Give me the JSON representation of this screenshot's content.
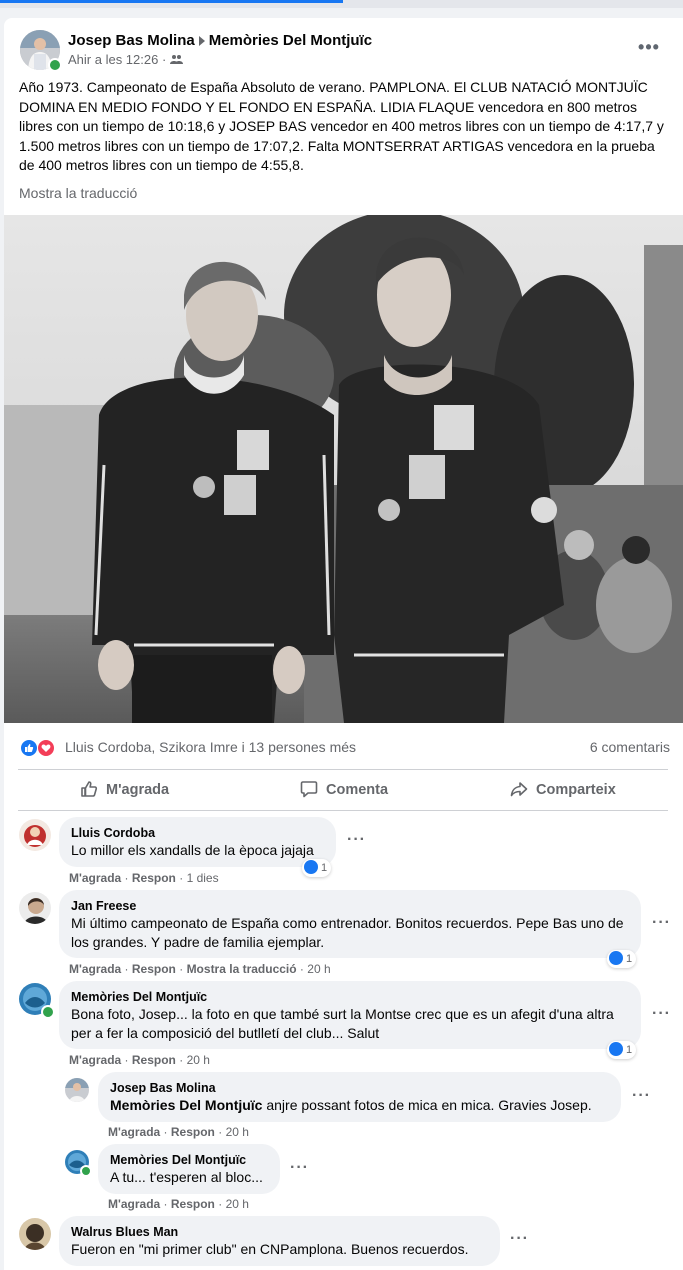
{
  "post": {
    "author": "Josep Bas Molina",
    "group": "Memòries Del Montjuïc",
    "timestamp": "Ahir a les 12:26",
    "audience_icon": "group-icon",
    "text": "Año 1973. Campeonato de España Absoluto de verano. PAMPLONA. El CLUB NATACIÓ MONTJUÏC DOMINA EN MEDIO FONDO Y EL FONDO EN ESPAÑA. LIDIA FLAQUE vencedora en 800 metros libres con un tiempo de 10:18,6 y JOSEP BAS vencedor en 400 metros libres con un tiempo de 4:17,7 y 1.500 metros libres con un tiempo de 17:07,2. Falta MONTSERRAT ARTIGAS vencedora en la prueba de 400 metros libres con un tiempo de 4:55,8.",
    "translate_link": "Mostra la traducció"
  },
  "reactions": {
    "names": "Lluis Cordoba, Szikora Imre i 13 persones més",
    "comments_count": "6 comentaris",
    "like_color": "#1877f2",
    "love_color": "#f33e58"
  },
  "actions": {
    "like": "M'agrada",
    "comment": "Comenta",
    "share": "Comparteix"
  },
  "comments": [
    {
      "name": "Lluis Cordoba",
      "text": "Lo millor els xandalls de la època jajaja",
      "like": "M'agrada",
      "reply": "Respon",
      "time": "1 dies",
      "likes": "1"
    },
    {
      "name": "Jan Freese",
      "text": "Mi último campeonato de España como entrenador. Bonitos recuerdos. Pepe Bas uno de los grandes. Y padre de familia ejemplar.",
      "like": "M'agrada",
      "reply": "Respon",
      "translate": "Mostra la traducció",
      "time": "20 h",
      "likes": "1"
    },
    {
      "name": "Memòries Del Montjuïc",
      "text": "Bona foto, Josep... la foto en que també surt la Montse crec que es un afegit d'una altra per a fer la composició del butlletí del club... Salut",
      "like": "M'agrada",
      "reply": "Respon",
      "time": "20 h",
      "likes": "1",
      "replies": [
        {
          "name": "Josep Bas Molina",
          "tag": "Memòries Del Montjuïc",
          "text": " anjre possant fotos de mica en mica. Gravies Josep.",
          "like": "M'agrada",
          "reply": "Respon",
          "time": "20 h"
        },
        {
          "name": "Memòries Del Montjuïc",
          "text": "A tu... t'esperen al bloc...",
          "like": "M'agrada",
          "reply": "Respon",
          "time": "20 h"
        }
      ]
    },
    {
      "name": "Walrus Blues Man",
      "text": "Fueron en \"mi primer club\" en CNPamplona. Buenos recuerdos."
    }
  ]
}
